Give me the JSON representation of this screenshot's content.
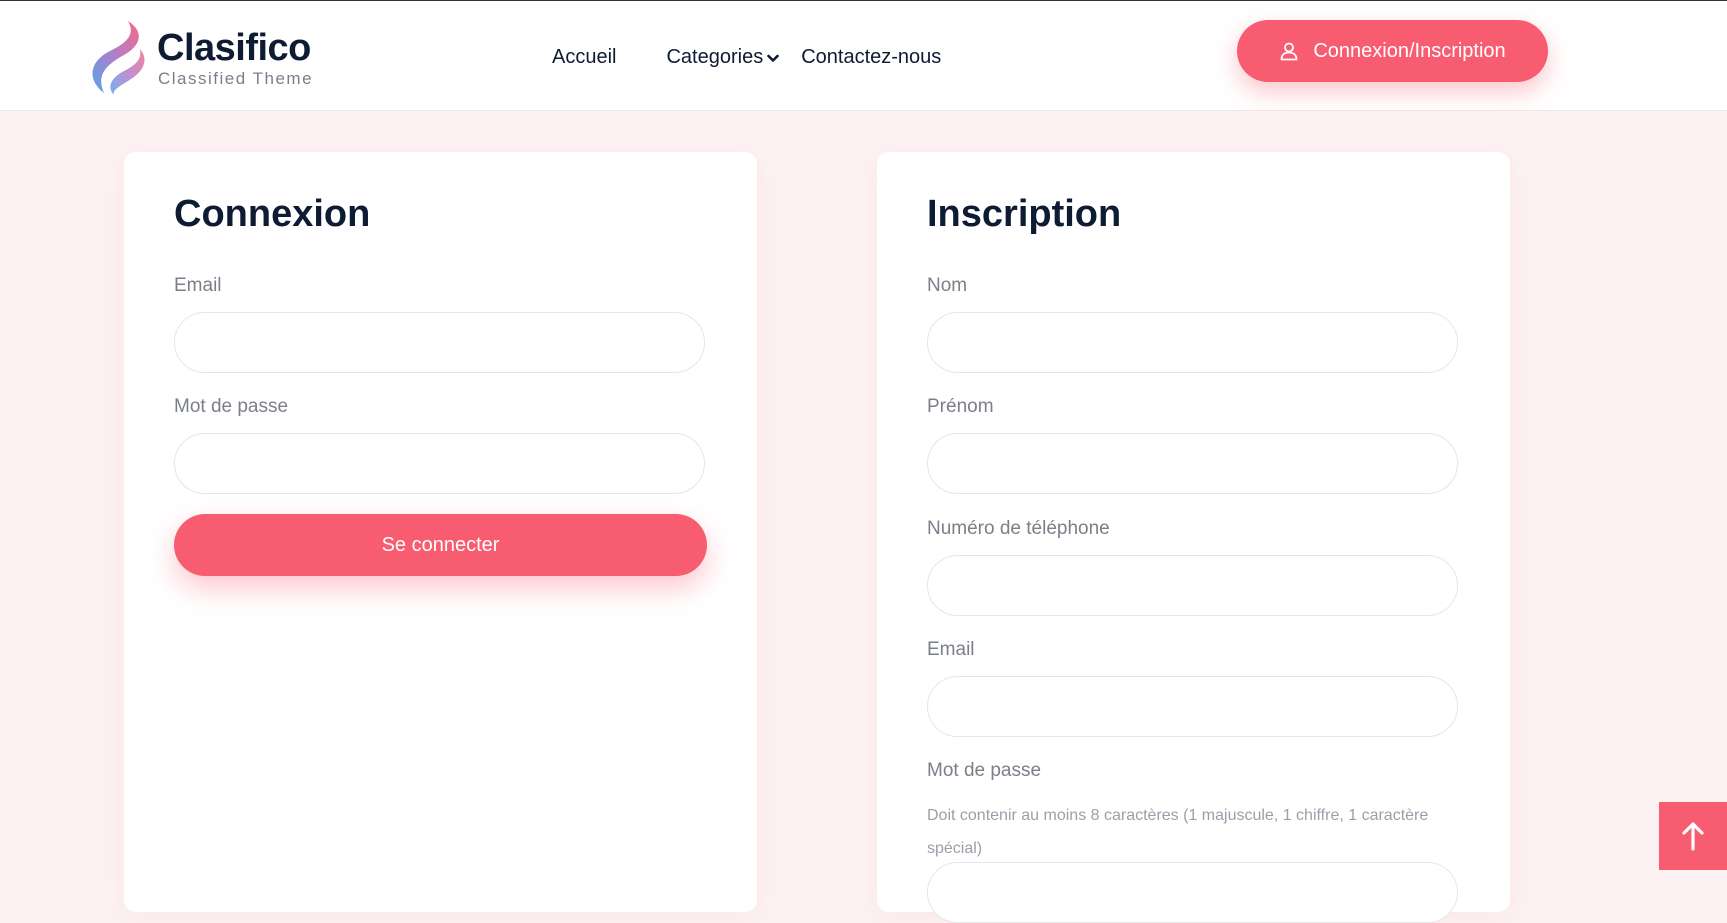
{
  "brand": {
    "name": "Clasifico",
    "tagline": "Classified Theme"
  },
  "nav": {
    "home": "Accueil",
    "categories": "Categories",
    "contact": "Contactez-nous"
  },
  "header_cta": {
    "label": "Connexion/Inscription"
  },
  "login": {
    "title": "Connexion",
    "email_label": "Email",
    "email_value": "",
    "password_label": "Mot de passe",
    "password_value": "",
    "submit_label": "Se connecter"
  },
  "register": {
    "title": "Inscription",
    "nom_label": "Nom",
    "prenom_label": "Prénom",
    "phone_label": "Numéro de téléphone",
    "email_label": "Email",
    "password_label": "Mot de passe",
    "password_hint": "Doit contenir au moins 8 caractères (1 majuscule, 1 chiffre, 1 caractère spécial)"
  },
  "icons": {
    "logo": "logo-mark-icon",
    "user": "user-icon",
    "chevron": "chevron-down-icon",
    "scroll_top": "arrow-up-icon"
  },
  "colors": {
    "accent": "#f85c71",
    "page_background": "#fdf2f3",
    "heading": "#0d1b33",
    "label": "#7b7f88"
  }
}
